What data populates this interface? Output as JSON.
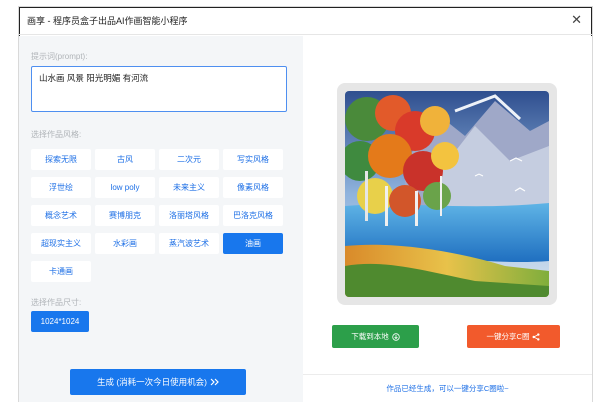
{
  "window": {
    "title": "画享 - 程序员盒子出品AI作画智能小程序",
    "close_glyph": "✕"
  },
  "prompt": {
    "label": "提示词(prompt):",
    "value": "山水画 风景 阳光明媚 有河流"
  },
  "styles": {
    "label": "选择作品风格:",
    "items": [
      {
        "label": "探索无限",
        "active": false
      },
      {
        "label": "古风",
        "active": false
      },
      {
        "label": "二次元",
        "active": false
      },
      {
        "label": "写实风格",
        "active": false
      },
      {
        "label": "浮世绘",
        "active": false
      },
      {
        "label": "low poly",
        "active": false
      },
      {
        "label": "未来主义",
        "active": false
      },
      {
        "label": "像素风格",
        "active": false
      },
      {
        "label": "概念艺术",
        "active": false
      },
      {
        "label": "赛博朋克",
        "active": false
      },
      {
        "label": "洛丽塔风格",
        "active": false
      },
      {
        "label": "巴洛克风格",
        "active": false
      },
      {
        "label": "超现实主义",
        "active": false
      },
      {
        "label": "水彩画",
        "active": false
      },
      {
        "label": "蒸汽波艺术",
        "active": false
      },
      {
        "label": "油画",
        "active": true
      },
      {
        "label": "卡通画",
        "active": false
      }
    ]
  },
  "size": {
    "label": "选择作品尺寸:",
    "value": "1024*1024"
  },
  "generate": {
    "label": "生成 (消耗一次今日使用机会)",
    "icon": "double-chevron-right-icon"
  },
  "result": {
    "download_label": "下载到本地",
    "download_icon": "download-circle-icon",
    "share_label": "一键分享C圈",
    "share_icon": "share-icon",
    "status": "作品已经生成，可以一键分享C圈啦~"
  },
  "colors": {
    "accent": "#1877ed",
    "download": "#2c9f4a",
    "share": "#f25a2c"
  }
}
